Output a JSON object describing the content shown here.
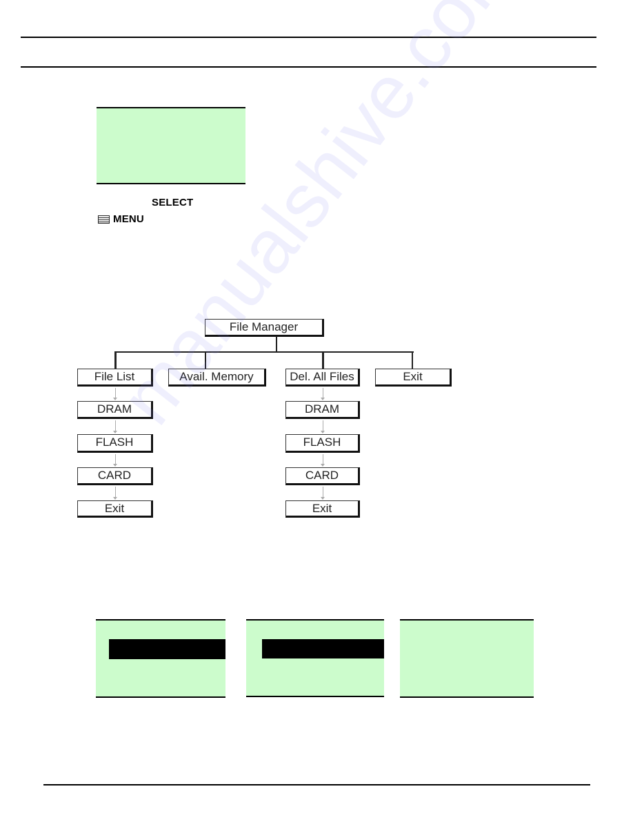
{
  "header": {
    "rules": [
      "top-rule",
      "bottom-rule"
    ]
  },
  "lcd_main": {
    "background": "#ccfccc",
    "lines": []
  },
  "keys": {
    "select_label": "SELECT",
    "menu_label": "MENU",
    "menu_icon": "menu-list-icon"
  },
  "diagram": {
    "root": "File Manager",
    "branches": [
      {
        "label": "File List",
        "children": [
          "DRAM",
          "FLASH",
          "CARD",
          "Exit"
        ]
      },
      {
        "label": "Avail. Memory",
        "children": []
      },
      {
        "label": "Del. All Files",
        "children": [
          "DRAM",
          "FLASH",
          "CARD",
          "Exit"
        ]
      },
      {
        "label": "Exit",
        "children": []
      }
    ]
  },
  "lcd_screens": [
    {
      "background": "#ccfccc",
      "highlighted_row": 1
    },
    {
      "background": "#ccfccc",
      "highlighted_row": 1
    },
    {
      "background": "#ccfccc",
      "highlighted_row": null
    }
  ],
  "watermark": "manualshive.com",
  "colors": {
    "lcd_green": "#ccfccc",
    "highlight": "#000000",
    "watermark": "#7878f0"
  }
}
